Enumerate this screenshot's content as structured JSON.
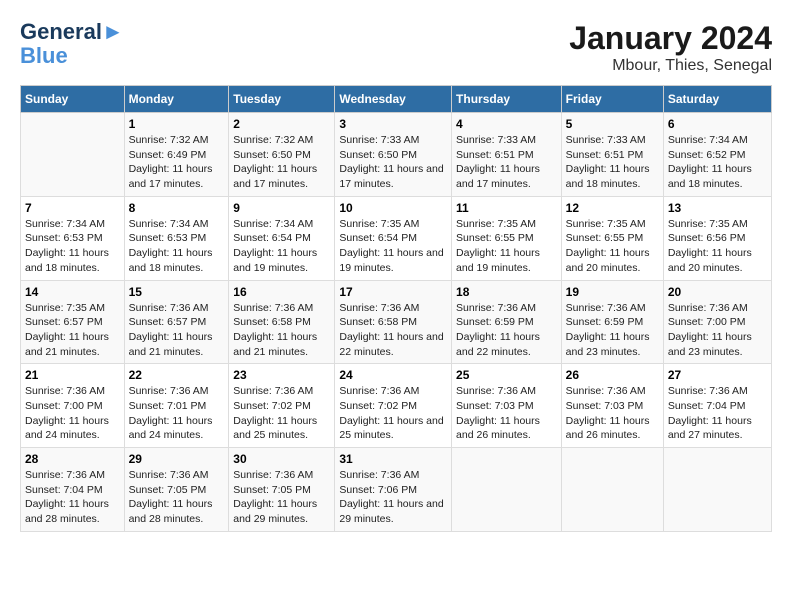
{
  "header": {
    "logo_line1": "General",
    "logo_line2": "Blue",
    "title": "January 2024",
    "subtitle": "Mbour, Thies, Senegal"
  },
  "days_of_week": [
    "Sunday",
    "Monday",
    "Tuesday",
    "Wednesday",
    "Thursday",
    "Friday",
    "Saturday"
  ],
  "weeks": [
    [
      {
        "day": "",
        "sunrise": "",
        "sunset": "",
        "daylight": ""
      },
      {
        "day": "1",
        "sunrise": "7:32 AM",
        "sunset": "6:49 PM",
        "daylight": "11 hours and 17 minutes."
      },
      {
        "day": "2",
        "sunrise": "7:32 AM",
        "sunset": "6:50 PM",
        "daylight": "11 hours and 17 minutes."
      },
      {
        "day": "3",
        "sunrise": "7:33 AM",
        "sunset": "6:50 PM",
        "daylight": "11 hours and 17 minutes."
      },
      {
        "day": "4",
        "sunrise": "7:33 AM",
        "sunset": "6:51 PM",
        "daylight": "11 hours and 17 minutes."
      },
      {
        "day": "5",
        "sunrise": "7:33 AM",
        "sunset": "6:51 PM",
        "daylight": "11 hours and 18 minutes."
      },
      {
        "day": "6",
        "sunrise": "7:34 AM",
        "sunset": "6:52 PM",
        "daylight": "11 hours and 18 minutes."
      }
    ],
    [
      {
        "day": "7",
        "sunrise": "7:34 AM",
        "sunset": "6:53 PM",
        "daylight": "11 hours and 18 minutes."
      },
      {
        "day": "8",
        "sunrise": "7:34 AM",
        "sunset": "6:53 PM",
        "daylight": "11 hours and 18 minutes."
      },
      {
        "day": "9",
        "sunrise": "7:34 AM",
        "sunset": "6:54 PM",
        "daylight": "11 hours and 19 minutes."
      },
      {
        "day": "10",
        "sunrise": "7:35 AM",
        "sunset": "6:54 PM",
        "daylight": "11 hours and 19 minutes."
      },
      {
        "day": "11",
        "sunrise": "7:35 AM",
        "sunset": "6:55 PM",
        "daylight": "11 hours and 19 minutes."
      },
      {
        "day": "12",
        "sunrise": "7:35 AM",
        "sunset": "6:55 PM",
        "daylight": "11 hours and 20 minutes."
      },
      {
        "day": "13",
        "sunrise": "7:35 AM",
        "sunset": "6:56 PM",
        "daylight": "11 hours and 20 minutes."
      }
    ],
    [
      {
        "day": "14",
        "sunrise": "7:35 AM",
        "sunset": "6:57 PM",
        "daylight": "11 hours and 21 minutes."
      },
      {
        "day": "15",
        "sunrise": "7:36 AM",
        "sunset": "6:57 PM",
        "daylight": "11 hours and 21 minutes."
      },
      {
        "day": "16",
        "sunrise": "7:36 AM",
        "sunset": "6:58 PM",
        "daylight": "11 hours and 21 minutes."
      },
      {
        "day": "17",
        "sunrise": "7:36 AM",
        "sunset": "6:58 PM",
        "daylight": "11 hours and 22 minutes."
      },
      {
        "day": "18",
        "sunrise": "7:36 AM",
        "sunset": "6:59 PM",
        "daylight": "11 hours and 22 minutes."
      },
      {
        "day": "19",
        "sunrise": "7:36 AM",
        "sunset": "6:59 PM",
        "daylight": "11 hours and 23 minutes."
      },
      {
        "day": "20",
        "sunrise": "7:36 AM",
        "sunset": "7:00 PM",
        "daylight": "11 hours and 23 minutes."
      }
    ],
    [
      {
        "day": "21",
        "sunrise": "7:36 AM",
        "sunset": "7:00 PM",
        "daylight": "11 hours and 24 minutes."
      },
      {
        "day": "22",
        "sunrise": "7:36 AM",
        "sunset": "7:01 PM",
        "daylight": "11 hours and 24 minutes."
      },
      {
        "day": "23",
        "sunrise": "7:36 AM",
        "sunset": "7:02 PM",
        "daylight": "11 hours and 25 minutes."
      },
      {
        "day": "24",
        "sunrise": "7:36 AM",
        "sunset": "7:02 PM",
        "daylight": "11 hours and 25 minutes."
      },
      {
        "day": "25",
        "sunrise": "7:36 AM",
        "sunset": "7:03 PM",
        "daylight": "11 hours and 26 minutes."
      },
      {
        "day": "26",
        "sunrise": "7:36 AM",
        "sunset": "7:03 PM",
        "daylight": "11 hours and 26 minutes."
      },
      {
        "day": "27",
        "sunrise": "7:36 AM",
        "sunset": "7:04 PM",
        "daylight": "11 hours and 27 minutes."
      }
    ],
    [
      {
        "day": "28",
        "sunrise": "7:36 AM",
        "sunset": "7:04 PM",
        "daylight": "11 hours and 28 minutes."
      },
      {
        "day": "29",
        "sunrise": "7:36 AM",
        "sunset": "7:05 PM",
        "daylight": "11 hours and 28 minutes."
      },
      {
        "day": "30",
        "sunrise": "7:36 AM",
        "sunset": "7:05 PM",
        "daylight": "11 hours and 29 minutes."
      },
      {
        "day": "31",
        "sunrise": "7:36 AM",
        "sunset": "7:06 PM",
        "daylight": "11 hours and 29 minutes."
      },
      {
        "day": "",
        "sunrise": "",
        "sunset": "",
        "daylight": ""
      },
      {
        "day": "",
        "sunrise": "",
        "sunset": "",
        "daylight": ""
      },
      {
        "day": "",
        "sunrise": "",
        "sunset": "",
        "daylight": ""
      }
    ]
  ]
}
